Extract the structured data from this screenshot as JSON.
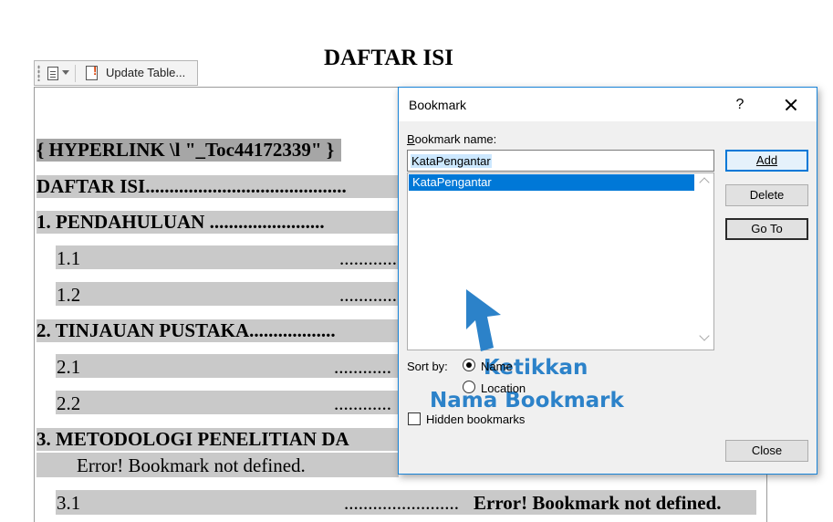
{
  "document": {
    "heading": "DAFTAR ISI",
    "toolbar": {
      "update_label": "Update Table..."
    },
    "field_code": "{ HYPERLINK \\l \"_Toc44172339\" }",
    "lines": [
      "DAFTAR ISI..........................................",
      "1.    PENDAHULUAN ........................",
      "1.1",
      "............",
      "1.2",
      "............",
      "2.    TINJAUAN PUSTAKA..................",
      "2.1",
      "............",
      "2.2",
      "............",
      "3.    METODOLOGI PENELITIAN DA",
      "Error! Bookmark not defined.",
      "3.1",
      "........................",
      "Error! Bookmark not defined."
    ]
  },
  "dialog": {
    "title": "Bookmark",
    "help": "?",
    "name_label": "Bookmark name:",
    "name_value": "KataPengantar",
    "list_items": [
      "KataPengantar"
    ],
    "annotation": [
      "Ketikkan",
      "Nama Bookmark"
    ],
    "buttons": {
      "add": "Add",
      "delete": "Delete",
      "goto": "Go To",
      "close": "Close"
    },
    "sort_by_label": "Sort by:",
    "sort_options": [
      "Name",
      "Location"
    ],
    "sort_selected": "Name",
    "hidden_label": "Hidden bookmarks",
    "hidden_checked": false,
    "colors": {
      "accent": "#0078d7",
      "annotation": "#2c82c9"
    }
  }
}
